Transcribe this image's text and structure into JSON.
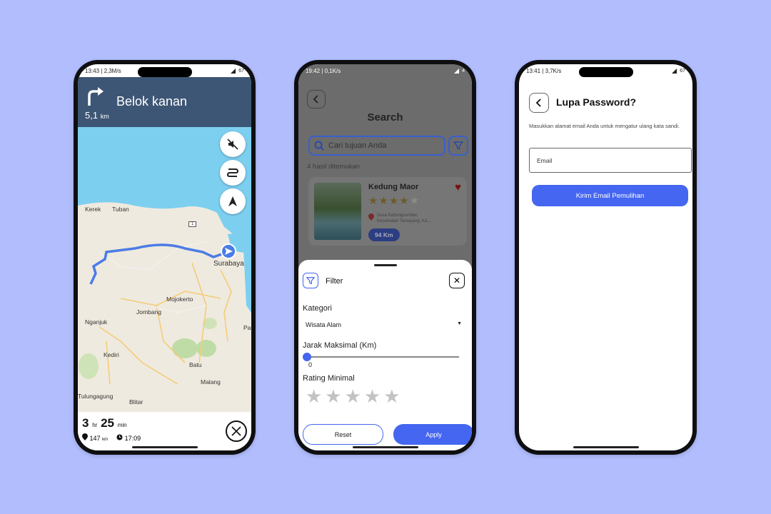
{
  "background_color": "#b1bdfd",
  "accent_color": "#4466f0",
  "navigation": {
    "status": {
      "time": "13:43",
      "speed": "2,3M/s",
      "battery": "67"
    },
    "instruction": "Belok kanan",
    "distance": "5,1",
    "distance_unit": "km",
    "cities": [
      "Kerek",
      "Tuban",
      "Surabaya",
      "Mojokerto",
      "Jombang",
      "Nganjuk",
      "Kediri",
      "Batu",
      "Malang",
      "Blitar",
      "Tulungagung",
      "Pas"
    ],
    "route_badge": "1",
    "eta": {
      "hours": "3",
      "hours_unit": "hr",
      "minutes": "25",
      "minutes_unit": "min",
      "distance": "147",
      "distance_unit": "km",
      "arrival": "17:09"
    }
  },
  "search": {
    "status": {
      "time": "19:42",
      "speed": "0,1K/s",
      "battery": "4"
    },
    "title": "Search",
    "placeholder": "Cari tujuan Anda",
    "result_count": "4 hasil ditemukan",
    "card": {
      "name": "Kedung Maor",
      "rating": 4,
      "address_line1": "Desa Kedungsumber,",
      "address_line2": "Kecamatan Temayang, Ka...",
      "distance": "94 Km"
    },
    "filter": {
      "title": "Filter",
      "category_label": "Kategori",
      "category_value": "Wisata Alam",
      "distance_label": "Jarak Maksimal (Km)",
      "distance_value": "0",
      "rating_label": "Rating Minimal",
      "reset_label": "Reset",
      "apply_label": "Apply"
    }
  },
  "forgot": {
    "status": {
      "time": "13:41",
      "speed": "3,7K/s",
      "battery": "67"
    },
    "title": "Lupa Password?",
    "description": "Masukkan alamat email Anda untuk mengatur ulang kata sandi.",
    "email_placeholder": "Email",
    "submit_label": "Kirim Email Pemulihan"
  }
}
